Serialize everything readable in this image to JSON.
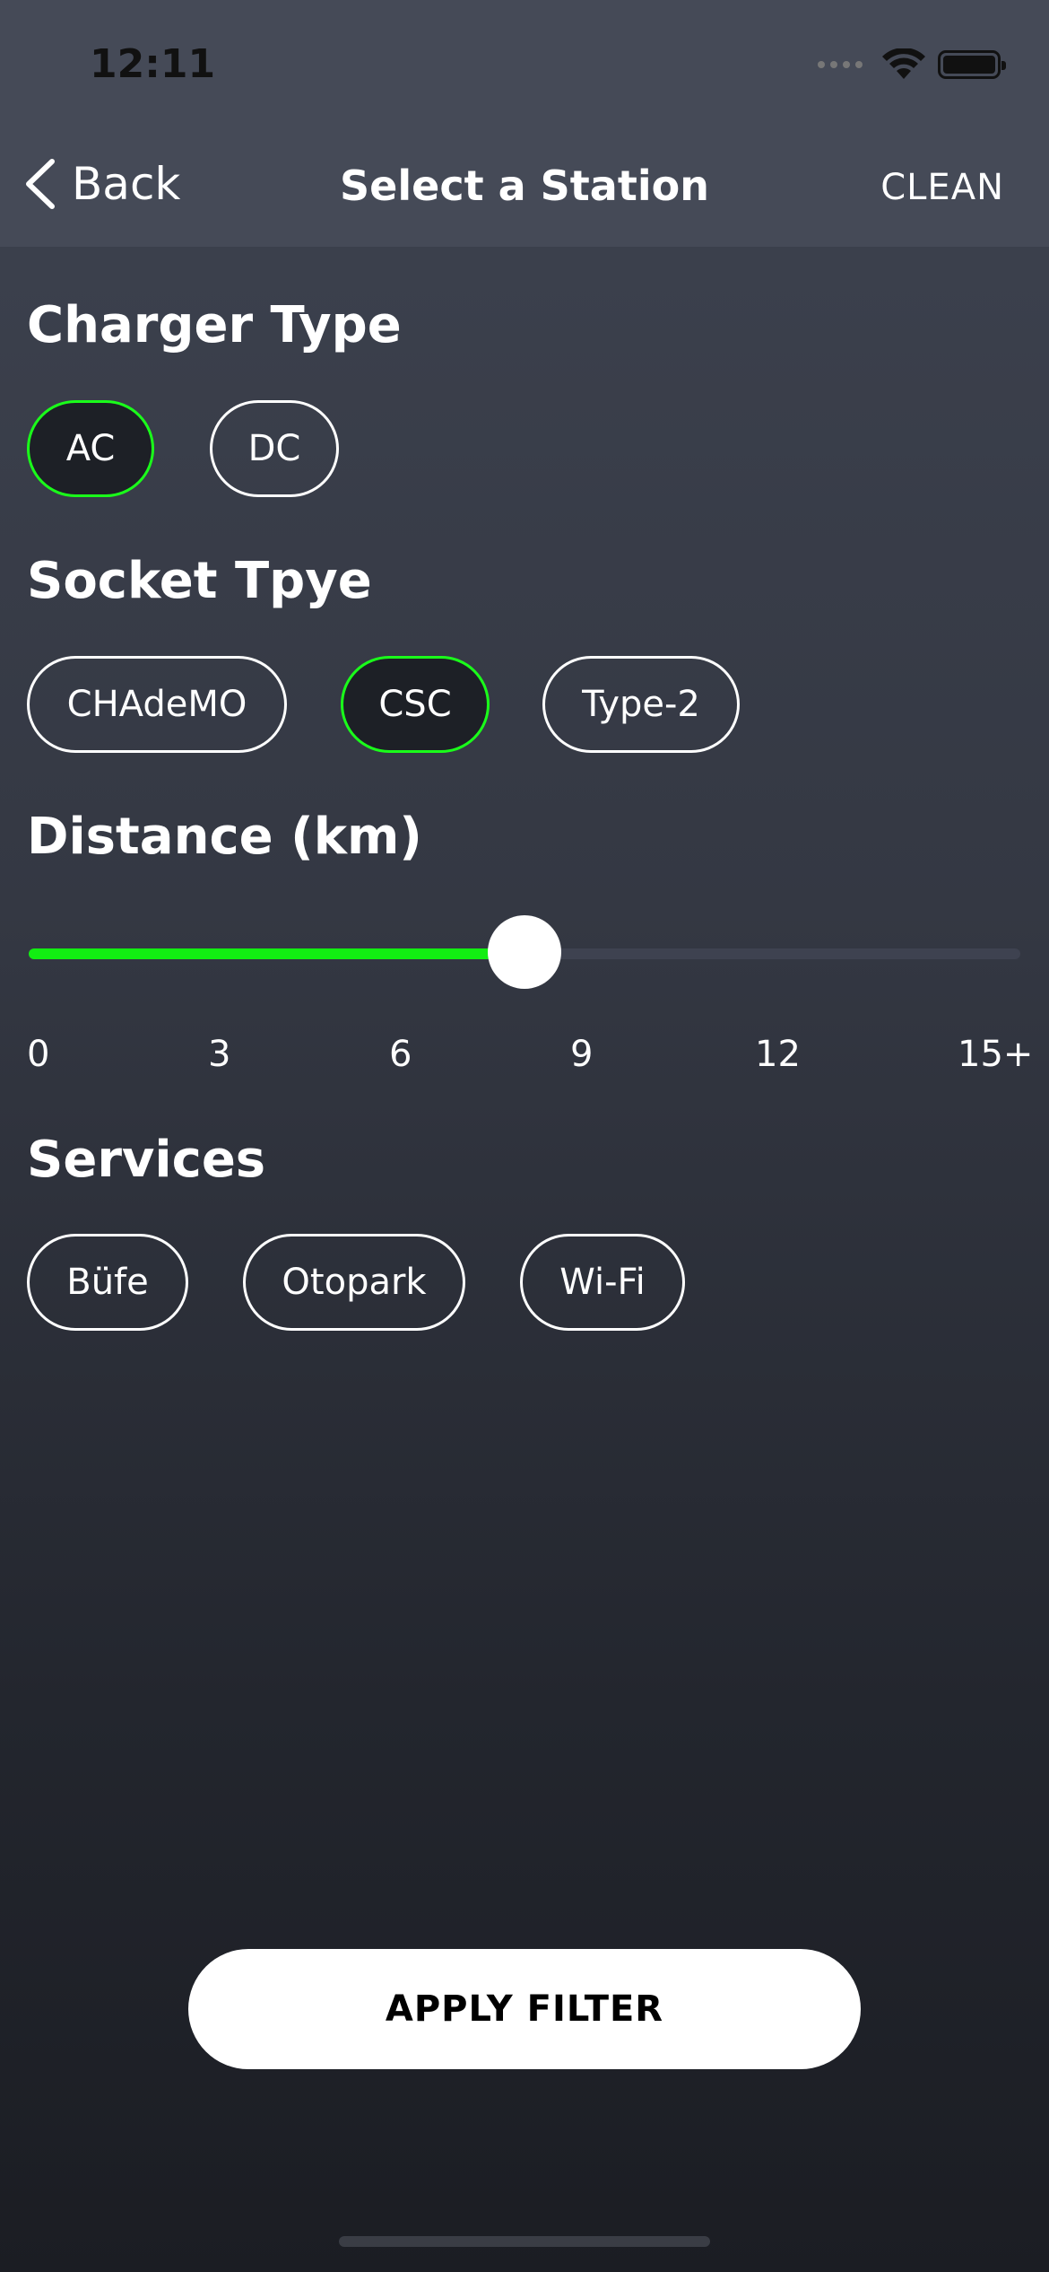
{
  "status_bar": {
    "time": "12:11"
  },
  "nav": {
    "back_label": "Back",
    "title": "Select a Station",
    "clean_label": "CLEAN"
  },
  "charger_type": {
    "title": "Charger Type",
    "options": [
      "AC",
      "DC"
    ],
    "selected": "AC"
  },
  "socket_type": {
    "title": "Socket Tpye",
    "options": [
      "CHAdeMO",
      "CSC",
      "Type-2"
    ],
    "selected": "CSC"
  },
  "distance": {
    "title": "Distance (km)",
    "ticks": [
      "0",
      "3",
      "6",
      "9",
      "12",
      "15+"
    ],
    "value": 7.5,
    "max": 15
  },
  "services": {
    "title": "Services",
    "options": [
      "Büfe",
      "Otopark",
      "Wi-Fi"
    ]
  },
  "apply_label": "APPLY FILTER",
  "colors": {
    "accent": "#12ee12",
    "background": "#343843",
    "nav": "#454a57"
  }
}
